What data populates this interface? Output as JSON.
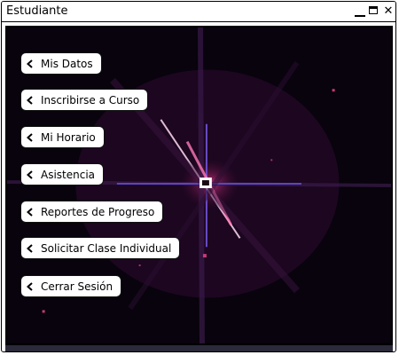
{
  "window": {
    "title": "Estudiante"
  },
  "controls": {
    "close_glyph": "✕"
  },
  "menu": {
    "items": [
      {
        "label": "Mis Datos",
        "icon": "chevron-left-icon"
      },
      {
        "label": "Inscribirse a Curso",
        "icon": "chevron-left-icon"
      },
      {
        "label": "Mi Horario",
        "icon": "chevron-left-icon"
      },
      {
        "label": "Asistencia",
        "icon": "chevron-left-icon"
      },
      {
        "label": "Reportes de Progreso",
        "icon": "chevron-left-icon"
      },
      {
        "label": "Solicitar Clase Individual",
        "icon": "chevron-left-icon"
      },
      {
        "label": "Cerrar Sesión",
        "icon": "chevron-left-icon"
      }
    ]
  },
  "background": {
    "description_colors": {
      "accent": "#e0408a",
      "beam": "#6a4cc8",
      "dark": "#0a0310"
    }
  }
}
